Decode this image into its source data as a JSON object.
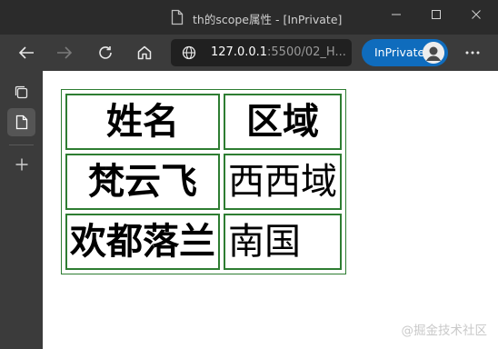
{
  "window": {
    "title": "th的scope属性 - [InPrivate]",
    "controls": [
      "minimize",
      "maximize",
      "close"
    ]
  },
  "toolbar": {
    "address_host": "127.0.0.1",
    "address_path": ":5500/02_H...",
    "inprivate_label": "InPrivate",
    "icons": [
      "back-icon",
      "forward-icon",
      "refresh-icon",
      "home-icon",
      "globe-icon",
      "more-icon"
    ]
  },
  "sidebar": {
    "icons": [
      "tab-actions-icon",
      "page-icon",
      "add-icon"
    ]
  },
  "table": {
    "headers": [
      "姓名",
      "区域"
    ],
    "rows": [
      {
        "header": "梵云飞",
        "cell": "西西域"
      },
      {
        "header": "欢都落兰",
        "cell": "南国"
      }
    ],
    "border_color": "#2e7d32"
  },
  "watermark": "@掘金技术社区",
  "colors": {
    "titlebar": "#2b2b2b",
    "toolbar": "#3b3b3b",
    "inprivate_accent": "#0f6cbd"
  }
}
